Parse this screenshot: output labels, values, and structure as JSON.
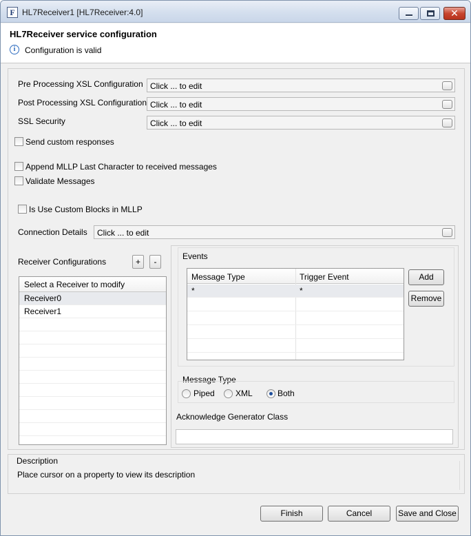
{
  "window": {
    "title": "HL7Receiver1 [HL7Receiver:4.0]",
    "app_icon": "F",
    "controls": {
      "minimize": "minimize-icon",
      "maximize": "maximize-icon",
      "close": "close-icon",
      "close_glyph": "✕"
    }
  },
  "header": {
    "title": "HL7Receiver service configuration",
    "status_icon": "i",
    "status": "Configuration is valid"
  },
  "config": {
    "pre_xsl_label": "Pre Processing XSL Configuration",
    "pre_xsl_value": "Click ... to edit",
    "post_xsl_label": "Post Processing XSL Configuration",
    "post_xsl_value": "Click ... to edit",
    "ssl_label": "SSL Security",
    "ssl_value": "Click ... to edit",
    "send_custom_label": "Send custom responses",
    "append_mllp_label": "Append MLLP Last Character to received messages",
    "validate_label": "Validate Messages",
    "custom_blocks_label": "Is Use Custom Blocks in MLLP",
    "connection_label": "Connection Details",
    "connection_value": "Click ... to edit"
  },
  "receivers": {
    "title": "Receiver Configurations",
    "add_label": "+",
    "remove_label": "-",
    "list_header": "Select a Receiver to modify",
    "items": [
      "Receiver0",
      "Receiver1"
    ],
    "selected_index": 0
  },
  "events": {
    "title": "Events",
    "columns": [
      "Message Type",
      "Trigger Event"
    ],
    "rows": [
      [
        "*",
        "*"
      ]
    ],
    "add_label": "Add",
    "remove_label": "Remove"
  },
  "message_type": {
    "title": "Message Type",
    "options": [
      "Piped",
      "XML",
      "Both"
    ],
    "selected": "Both"
  },
  "ack": {
    "label": "Acknowledge Generator Class",
    "value": ""
  },
  "description": {
    "title": "Description",
    "text": "Place cursor on a property to view its description"
  },
  "footer": {
    "finish": "Finish",
    "cancel": "Cancel",
    "save_close": "Save and Close"
  }
}
